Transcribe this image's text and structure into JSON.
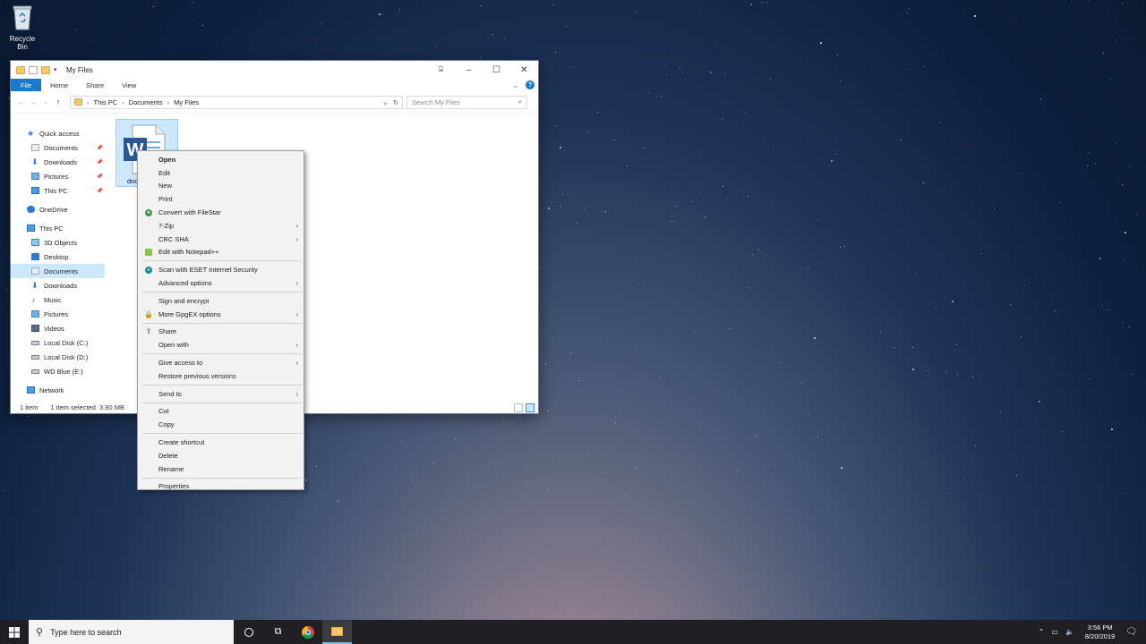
{
  "desktop": {
    "recycle_bin_label": "Recycle Bin"
  },
  "window": {
    "title": "My Files",
    "ribbon_tabs": [
      "File",
      "Home",
      "Share",
      "View"
    ],
    "breadcrumb": [
      "This PC",
      "Documents",
      "My Files"
    ],
    "search_placeholder": "Search My Files",
    "nav": {
      "quick_access": "Quick access",
      "qa_items": [
        "Documents",
        "Downloads",
        "Pictures",
        "This PC"
      ],
      "onedrive": "OneDrive",
      "this_pc": "This PC",
      "pc_items": [
        "3D Objects",
        "Desktop",
        "Documents",
        "Downloads",
        "Music",
        "Pictures",
        "Videos",
        "Local Disk (C:)",
        "Local Disk (D:)",
        "WD Blue (E:)"
      ],
      "network": "Network"
    },
    "file_name": "doc",
    "status": {
      "count": "1 item",
      "selected": "1 item selected  3.90 MB"
    }
  },
  "context_menu": {
    "open": "Open",
    "edit": "Edit",
    "new": "New",
    "print": "Print",
    "convert_filestar": "Convert with FileStar",
    "seven_zip": "7-Zip",
    "crc_sha": "CRC SHA",
    "edit_notepad": "Edit with Notepad++",
    "eset_scan": "Scan with ESET Internet Security",
    "advanced_options": "Advanced options",
    "sign_encrypt": "Sign and encrypt",
    "more_gpgex": "More GpgEX options",
    "share": "Share",
    "open_with": "Open with",
    "give_access": "Give access to",
    "restore_versions": "Restore previous versions",
    "send_to": "Send to",
    "cut": "Cut",
    "copy": "Copy",
    "create_shortcut": "Create shortcut",
    "delete": "Delete",
    "rename": "Rename",
    "properties": "Properties"
  },
  "taskbar": {
    "search_placeholder": "Type here to search",
    "time": "3:56 PM",
    "date": "8/20/2019"
  },
  "colors": {
    "accent": "#1979ca",
    "selection": "#cce8ff",
    "taskbar": "#1f1f24"
  }
}
